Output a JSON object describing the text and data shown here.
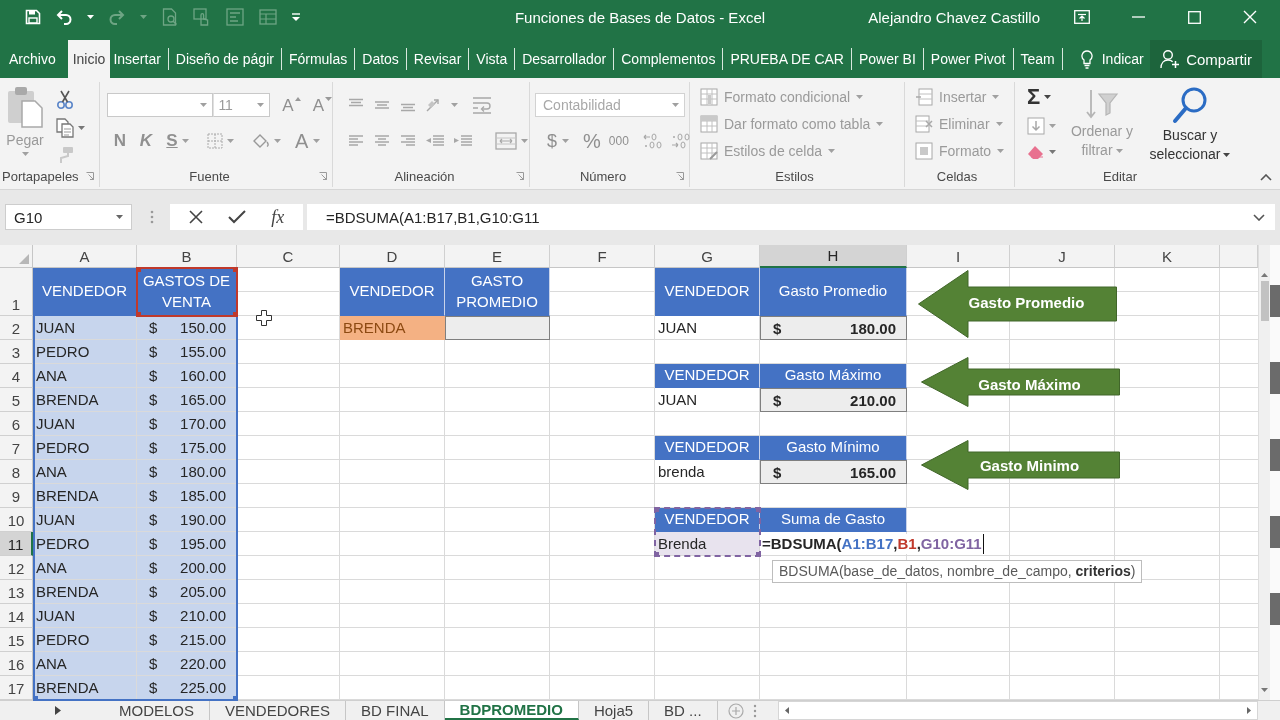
{
  "title_bar": {
    "title": "Funciones de Bases de Datos - Excel",
    "user": "Alejandro Chavez Castillo"
  },
  "ribbon_tabs": [
    {
      "label": "Archivo",
      "selected": false
    },
    {
      "label": "Inicio",
      "selected": true
    },
    {
      "label": "Insertar",
      "selected": false
    },
    {
      "label": "Diseño de págir",
      "selected": false
    },
    {
      "label": "Fórmulas",
      "selected": false
    },
    {
      "label": "Datos",
      "selected": false
    },
    {
      "label": "Revisar",
      "selected": false
    },
    {
      "label": "Vista",
      "selected": false
    },
    {
      "label": "Desarrollador",
      "selected": false
    },
    {
      "label": "Complementos",
      "selected": false
    },
    {
      "label": "PRUEBA DE CAR",
      "selected": false
    },
    {
      "label": "Power BI",
      "selected": false
    },
    {
      "label": "Power Pivot",
      "selected": false
    },
    {
      "label": "Team",
      "selected": false
    }
  ],
  "tell_me": "Indicar",
  "share_button": "Compartir",
  "ribbon": {
    "clipboard": {
      "label": "Portapapeles",
      "paste": {
        "label": "Pegar",
        "disabled": true
      }
    },
    "font": {
      "label": "Fuente",
      "size": "11",
      "grow": "A",
      "shrink": "A",
      "styles": [
        "N",
        "K",
        "S"
      ],
      "font_color_button": "A"
    },
    "alignment": {
      "label": "Alineación"
    },
    "number": {
      "label": "Número",
      "format": "Contabilidad",
      "currency": "$",
      "percent": "%",
      "thousands": "000"
    },
    "styles": {
      "label": "Estilos",
      "commands": [
        {
          "label": "Formato condicional",
          "disabled": true
        },
        {
          "label": "Dar formato como tabla",
          "disabled": true
        },
        {
          "label": "Estilos de celda",
          "disabled": true
        }
      ]
    },
    "cells": {
      "label": "Celdas",
      "commands": [
        {
          "label": "Insertar",
          "disabled": true
        },
        {
          "label": "Eliminar",
          "disabled": true
        },
        {
          "label": "Formato",
          "disabled": true
        }
      ]
    },
    "editing": {
      "label": "Editar",
      "autosum": "Σ",
      "sort": {
        "label": "Ordenar y filtrar",
        "disabled": true
      },
      "find": {
        "label": "Buscar y seleccionar",
        "disabled": false
      }
    }
  },
  "formula_bar": {
    "name_box": "G10",
    "function_button": "fx",
    "formula": "=BDSUMA(A1:B17,B1,G10:G11"
  },
  "sheet": {
    "columns": [
      {
        "label": "A",
        "selected": false
      },
      {
        "label": "B",
        "selected": false
      },
      {
        "label": "C",
        "selected": false
      },
      {
        "label": "D",
        "selected": false
      },
      {
        "label": "E",
        "selected": false
      },
      {
        "label": "F",
        "selected": false
      },
      {
        "label": "G",
        "selected": false
      },
      {
        "label": "H",
        "selected": true
      },
      {
        "label": "I",
        "selected": false
      },
      {
        "label": "J",
        "selected": false
      },
      {
        "label": "K",
        "selected": false
      }
    ],
    "rows": [
      {
        "label": "1",
        "selected": false
      },
      {
        "label": "2",
        "selected": false
      },
      {
        "label": "3",
        "selected": false
      },
      {
        "label": "4",
        "selected": false
      },
      {
        "label": "5",
        "selected": false
      },
      {
        "label": "6",
        "selected": false
      },
      {
        "label": "7",
        "selected": false
      },
      {
        "label": "8",
        "selected": false
      },
      {
        "label": "9",
        "selected": false
      },
      {
        "label": "10",
        "selected": false
      },
      {
        "label": "11",
        "selected": true
      },
      {
        "label": "12",
        "selected": false
      },
      {
        "label": "13",
        "selected": false
      },
      {
        "label": "14",
        "selected": false
      },
      {
        "label": "15",
        "selected": false
      },
      {
        "label": "16",
        "selected": false
      },
      {
        "label": "17",
        "selected": false
      }
    ],
    "sales_table": {
      "headers": [
        "VENDEDOR",
        "GASTOS DE VENTA"
      ],
      "rows": [
        {
          "seller": "JUAN",
          "currency": "$",
          "amount": "150.00"
        },
        {
          "seller": "PEDRO",
          "currency": "$",
          "amount": "155.00"
        },
        {
          "seller": "ANA",
          "currency": "$",
          "amount": "160.00"
        },
        {
          "seller": "BRENDA",
          "currency": "$",
          "amount": "165.00"
        },
        {
          "seller": "JUAN",
          "currency": "$",
          "amount": "170.00"
        },
        {
          "seller": "PEDRO",
          "currency": "$",
          "amount": "175.00"
        },
        {
          "seller": "ANA",
          "currency": "$",
          "amount": "180.00"
        },
        {
          "seller": "BRENDA",
          "currency": "$",
          "amount": "185.00"
        },
        {
          "seller": "JUAN",
          "currency": "$",
          "amount": "190.00"
        },
        {
          "seller": "PEDRO",
          "currency": "$",
          "amount": "195.00"
        },
        {
          "seller": "ANA",
          "currency": "$",
          "amount": "200.00"
        },
        {
          "seller": "BRENDA",
          "currency": "$",
          "amount": "205.00"
        },
        {
          "seller": "JUAN",
          "currency": "$",
          "amount": "210.00"
        },
        {
          "seller": "PEDRO",
          "currency": "$",
          "amount": "215.00"
        },
        {
          "seller": "ANA",
          "currency": "$",
          "amount": "220.00"
        },
        {
          "seller": "BRENDA",
          "currency": "$",
          "amount": "225.00"
        }
      ]
    },
    "criteria_table": {
      "headers": [
        "VENDEDOR",
        "GASTO PROMEDIO"
      ],
      "seller": "BRENDA"
    },
    "result_tables": [
      {
        "kind": "value",
        "headers": [
          "VENDEDOR",
          "Gasto Promedio"
        ],
        "seller": "JUAN",
        "currency": "$",
        "amount": "180.00"
      },
      {
        "kind": "value",
        "headers": [
          "VENDEDOR",
          "Gasto Máximo"
        ],
        "seller": "JUAN",
        "currency": "$",
        "amount": "210.00"
      },
      {
        "kind": "value",
        "headers": [
          "VENDEDOR",
          "Gasto Mínimo"
        ],
        "seller": "brenda",
        "currency": "$",
        "amount": "165.00"
      },
      {
        "kind": "editing",
        "headers": [
          "VENDEDOR",
          "Suma de Gasto"
        ],
        "seller": "Brenda",
        "formula": [
          {
            "kind": "text",
            "text": "=BDSUMA("
          },
          {
            "kind": "reference",
            "text": "A1:B17",
            "color": "#4472c4"
          },
          {
            "kind": "text",
            "text": ","
          },
          {
            "kind": "reference",
            "text": "B1",
            "color": "#c0392b"
          },
          {
            "kind": "text",
            "text": ","
          },
          {
            "kind": "reference",
            "text": "G10:G11",
            "color": "#8064a2"
          }
        ]
      }
    ],
    "arrows": [
      {
        "label": "Gasto Promedio"
      },
      {
        "label": "Gasto Máximo"
      },
      {
        "label": "Gasto Minimo"
      }
    ],
    "tooltip": "BDSUMA(base_de_datos, nombre_de_campo, **criterios**)"
  },
  "sheet_tabs": [
    {
      "label": "MODELOS",
      "selected": false
    },
    {
      "label": "VENDEDORES",
      "selected": false
    },
    {
      "label": "BD FINAL",
      "selected": false
    },
    {
      "label": "BDPROMEDIO",
      "selected": true
    },
    {
      "label": "Hoja5",
      "selected": false
    },
    {
      "label": "BD ...",
      "selected": false
    }
  ]
}
